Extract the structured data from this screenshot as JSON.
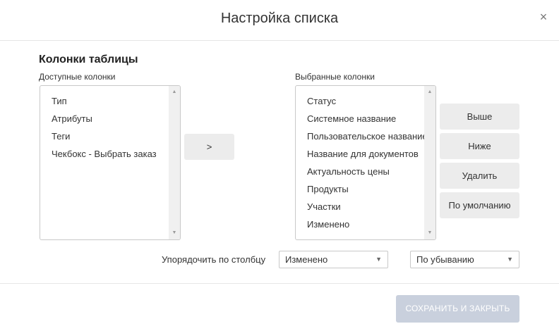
{
  "dialog": {
    "title": "Настройка списка",
    "close_glyph": "×"
  },
  "columns": {
    "section_title": "Колонки таблицы",
    "available_label": "Доступные колонки",
    "selected_label": "Выбранные колонки",
    "available_items": [
      "Тип",
      "Атрибуты",
      "Теги",
      "Чекбокс - Выбрать заказ"
    ],
    "selected_items": [
      "Статус",
      "Системное название",
      "Пользовательское название",
      "Название для документов",
      "Актуальность цены",
      "Продукты",
      "Участки",
      "Изменено"
    ],
    "move_button": ">",
    "buttons": {
      "up": "Выше",
      "down": "Ниже",
      "delete": "Удалить",
      "default": "По умолчанию"
    }
  },
  "sorting": {
    "label": "Упорядочить по столбцу",
    "column_value": "Изменено",
    "order_value": "По убыванию"
  },
  "footer": {
    "save_button": "СОХРАНИТЬ И ЗАКРЫТЬ"
  },
  "icons": {
    "scroll_up": "▲",
    "scroll_down": "▼",
    "dropdown": "▼"
  }
}
